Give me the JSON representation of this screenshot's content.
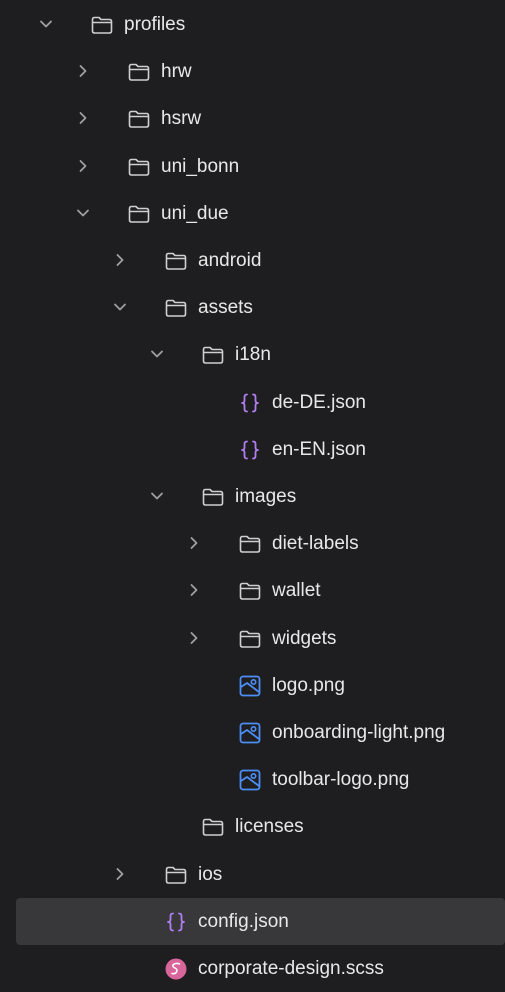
{
  "colors": {
    "background": "#1e1e20",
    "selected_row": "#38383b",
    "folder_stroke": "#cfcfcf",
    "json_icon": "#b07ef0",
    "image_icon": "#4c8ef5",
    "scss_icon": "#d9669b",
    "chevron": "#a0a0a0"
  },
  "tree": [
    {
      "label": "profiles",
      "type": "folder",
      "state": "expanded",
      "depth": 0
    },
    {
      "label": "hrw",
      "type": "folder",
      "state": "collapsed",
      "depth": 1
    },
    {
      "label": "hsrw",
      "type": "folder",
      "state": "collapsed",
      "depth": 1
    },
    {
      "label": "uni_bonn",
      "type": "folder",
      "state": "collapsed",
      "depth": 1
    },
    {
      "label": "uni_due",
      "type": "folder",
      "state": "expanded",
      "depth": 1
    },
    {
      "label": "android",
      "type": "folder",
      "state": "collapsed",
      "depth": 2
    },
    {
      "label": "assets",
      "type": "folder",
      "state": "expanded",
      "depth": 2
    },
    {
      "label": "i18n",
      "type": "folder",
      "state": "expanded",
      "depth": 3
    },
    {
      "label": "de-DE.json",
      "type": "json",
      "state": "none",
      "depth": 4
    },
    {
      "label": "en-EN.json",
      "type": "json",
      "state": "none",
      "depth": 4
    },
    {
      "label": "images",
      "type": "folder",
      "state": "expanded",
      "depth": 3
    },
    {
      "label": "diet-labels",
      "type": "folder",
      "state": "collapsed",
      "depth": 4
    },
    {
      "label": "wallet",
      "type": "folder",
      "state": "collapsed",
      "depth": 4
    },
    {
      "label": "widgets",
      "type": "folder",
      "state": "collapsed",
      "depth": 4
    },
    {
      "label": "logo.png",
      "type": "image",
      "state": "none",
      "depth": 4
    },
    {
      "label": "onboarding-light.png",
      "type": "image",
      "state": "none",
      "depth": 4
    },
    {
      "label": "toolbar-logo.png",
      "type": "image",
      "state": "none",
      "depth": 4
    },
    {
      "label": "licenses",
      "type": "folder",
      "state": "none",
      "depth": 3
    },
    {
      "label": "ios",
      "type": "folder",
      "state": "collapsed",
      "depth": 2
    },
    {
      "label": "config.json",
      "type": "json",
      "state": "none",
      "depth": 2,
      "selected": true
    },
    {
      "label": "corporate-design.scss",
      "type": "scss",
      "state": "none",
      "depth": 2
    }
  ]
}
